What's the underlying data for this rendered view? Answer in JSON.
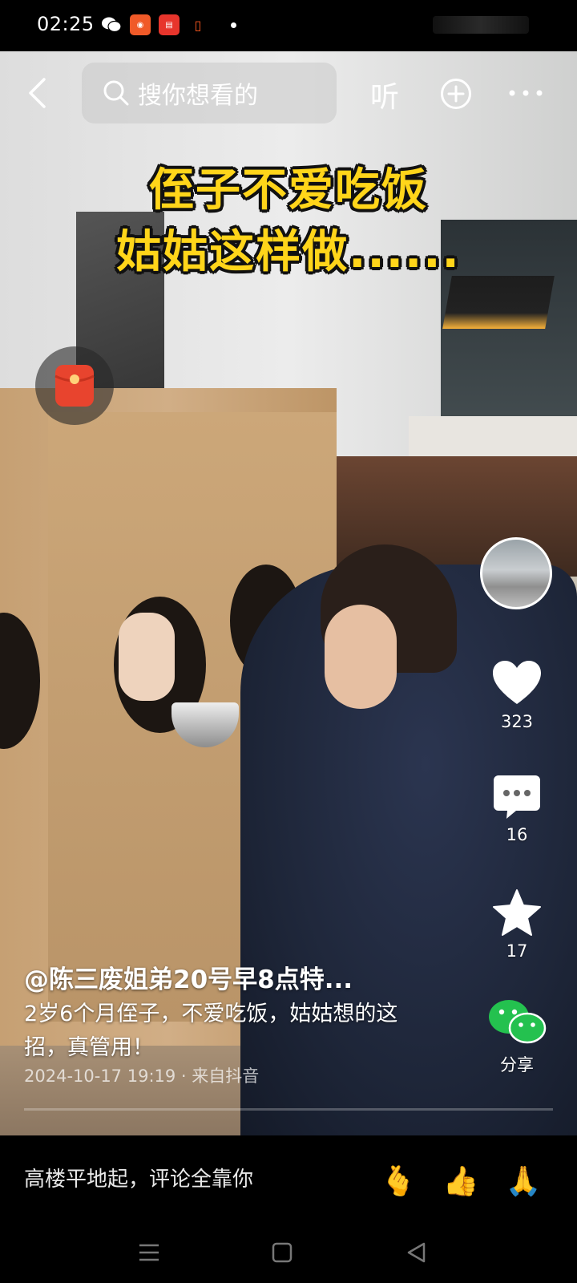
{
  "status_bar": {
    "time": "02:25"
  },
  "top_bar": {
    "search_placeholder": "搜你想看的",
    "listen_label": "听"
  },
  "video": {
    "caption_line1": "侄子不爱吃饭",
    "caption_line2": "姑姑这样做......"
  },
  "actions": {
    "like_count": "323",
    "comment_count": "16",
    "favorite_count": "17",
    "share_label": "分享"
  },
  "post": {
    "author": "@陈三废姐弟20号早8点特...",
    "description": "2岁6个月侄子，不爱吃饭，姑姑想的这招，真管用！",
    "meta": "2024-10-17 19:19 · 来自抖音"
  },
  "comment_bar": {
    "placeholder": "高楼平地起，评论全靠你",
    "emojis": [
      "🫰",
      "👍",
      "🙏"
    ]
  },
  "icons": {
    "back": "back-chevron-icon",
    "search": "search-icon",
    "plus": "plus-circle-icon",
    "more": "more-dots-icon",
    "red_packet": "red-packet-icon",
    "like": "heart-icon",
    "comment": "comment-bubble-icon",
    "favorite": "star-icon",
    "share": "wechat-icon"
  },
  "colors": {
    "caption_yellow": "#ffd51a",
    "wechat_green": "#24c14f",
    "red_packet": "#e8442e"
  }
}
